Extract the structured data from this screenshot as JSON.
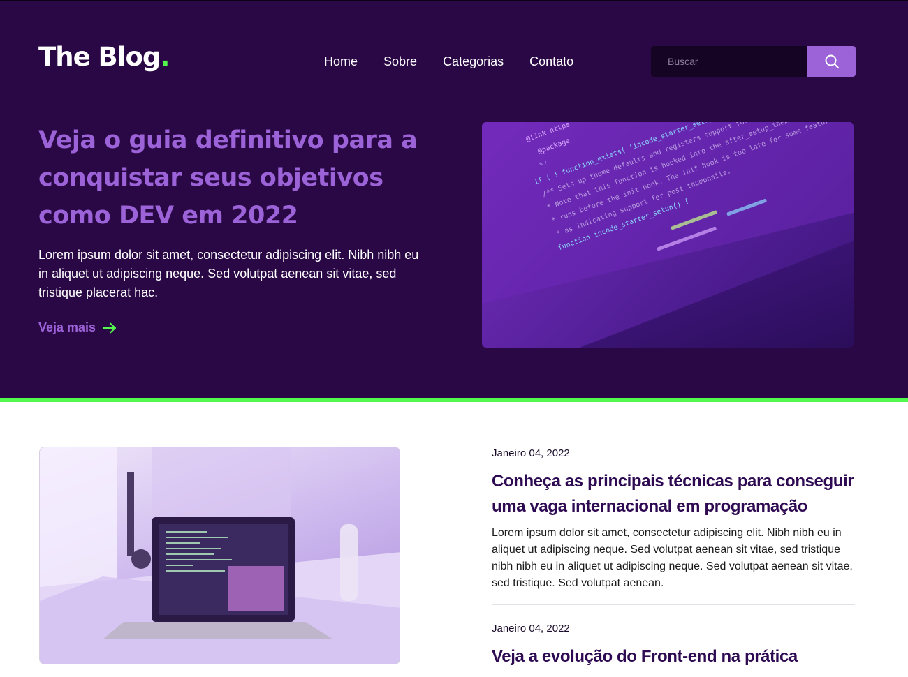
{
  "header": {
    "logo_text": "The Blog",
    "logo_dot": ".",
    "nav": [
      {
        "label": "Home"
      },
      {
        "label": "Sobre"
      },
      {
        "label": "Categorias"
      },
      {
        "label": "Contato"
      }
    ],
    "search": {
      "placeholder": "Buscar",
      "button_icon": "search-icon"
    }
  },
  "hero": {
    "title": "Veja o guia definitivo para a conquistar seus objetivos como DEV em 2022",
    "text": "Lorem ipsum dolor sit amet, consectetur adipiscing elit. Nibh nibh eu in aliquet ut adipiscing neque. Sed volutpat aenean sit vitae, sed tristique placerat hac.",
    "link_label": "Veja mais",
    "link_icon": "arrow-right-icon",
    "image_code_lines": [
      "@link https",
      "@package",
      "*/",
      "if ( ! function_exists( 'incode_starter_setup' ) ) :",
      "/** Sets up theme defaults and registers support for various WordPress features.",
      " * Note that this function is hooked into the after_setup_theme hook, which",
      " * runs before the init hook. The init hook is too late for some features, such",
      " * as indicating support for post thumbnails.",
      "function incode_starter_setup() {"
    ]
  },
  "colors": {
    "hero_bg": "#290845",
    "accent_purple": "#9c63d8",
    "accent_green": "#53f84c",
    "title_dark": "#2e0a52"
  },
  "posts": [
    {
      "date": "Janeiro 04, 2022",
      "title": "Conheça as principais técnicas para conseguir uma vaga internacional em programação",
      "text": "Lorem ipsum dolor sit amet, consectetur adipiscing elit. Nibh nibh eu in aliquet ut adipiscing neque. Sed volutpat aenean sit vitae, sed tristique nibh nibh eu in aliquet ut adipiscing neque. Sed volutpat aenean sit vitae, sed tristique. Sed volutpat aenean."
    },
    {
      "date": "Janeiro 04, 2022",
      "title": "Veja a evolução do Front-end na prática"
    }
  ]
}
